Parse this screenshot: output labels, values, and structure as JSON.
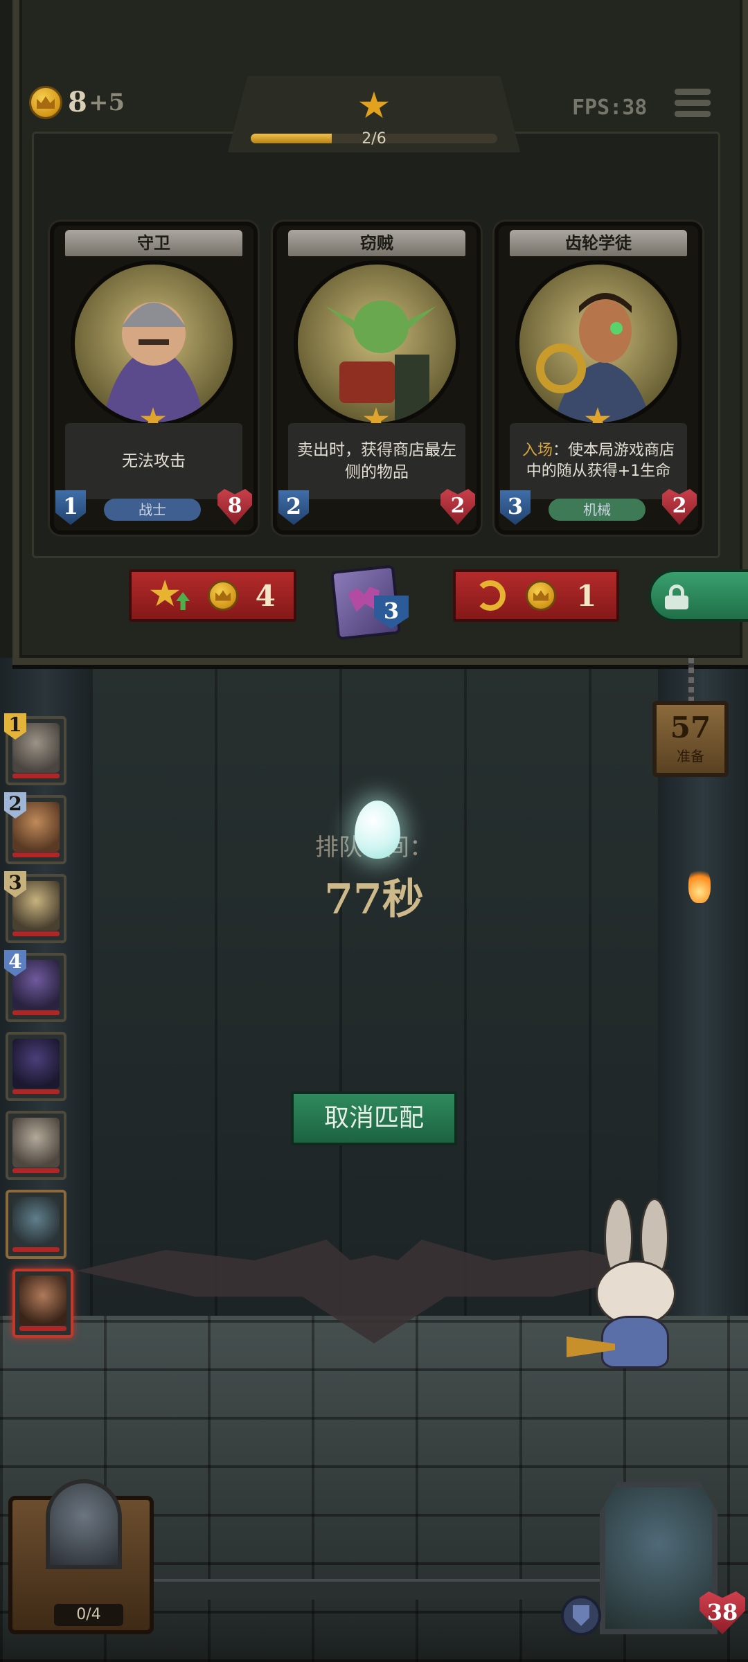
{
  "hud": {
    "gold": "8",
    "gold_income": "+5",
    "fps": "FPS:38",
    "tier_progress_text": "2/6",
    "tier_progress": 0.33
  },
  "shop": {
    "cards": [
      {
        "name": "守卫",
        "desc": "无法攻击",
        "desc_keyword": "",
        "attack": "1",
        "health": "8",
        "tribe": "战士",
        "tribe_color": "#3e5f8f"
      },
      {
        "name": "窃贼",
        "desc": "卖出时，获得商店最左侧的物品",
        "desc_keyword": "",
        "attack": "2",
        "health": "2",
        "tribe": "",
        "tribe_color": ""
      },
      {
        "name": "齿轮学徒",
        "desc": "：使本局游戏商店中的随从获得+1生命",
        "desc_keyword": "入场",
        "attack": "3",
        "health": "2",
        "tribe": "机械",
        "tribe_color": "#3e7a55"
      }
    ],
    "upgrade_cost": "4",
    "spell_count": "3",
    "refresh_cost": "1"
  },
  "match": {
    "queue_label": "排队时间：",
    "queue_time": "77秒",
    "cancel_label": "取消匹配",
    "ready_count": "57",
    "ready_label": "准备"
  },
  "lineup": [
    {
      "num": "1",
      "color": "#e3b33a"
    },
    {
      "num": "2",
      "color": "#9fb6d6"
    },
    {
      "num": "3",
      "color": "#c7b27e"
    },
    {
      "num": "4",
      "color": "#5b7fbf"
    },
    {
      "num": "",
      "color": ""
    },
    {
      "num": "",
      "color": ""
    },
    {
      "num": "",
      "color": ""
    },
    {
      "num": "",
      "color": ""
    }
  ],
  "bottom": {
    "hero_slots": "0/4",
    "life": "38"
  }
}
